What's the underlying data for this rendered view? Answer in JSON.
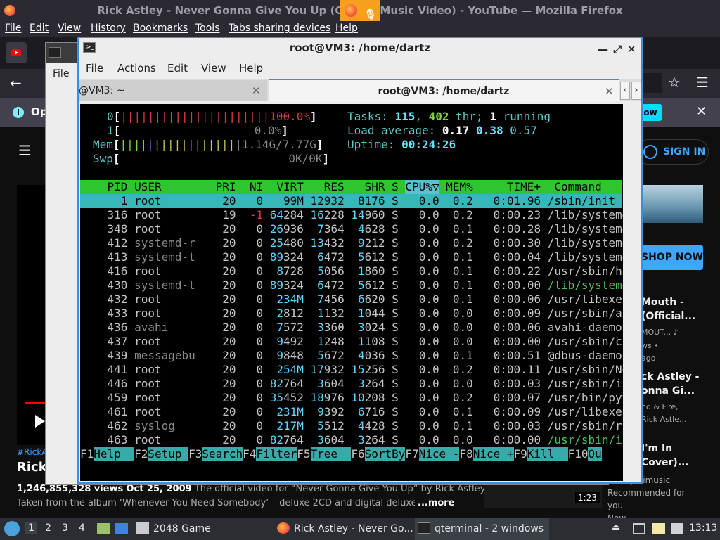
{
  "firefox": {
    "window_title": "Rick Astley - Never Gonna Give You Up (Official Music Video) - YouTube — Mozilla Firefox",
    "menu": [
      "File",
      "Edit",
      "View",
      "History",
      "Bookmarks",
      "Tools",
      "Tabs sharing devices",
      "Help"
    ],
    "notice_text": "Op",
    "notice_button": "ow",
    "youtube": {
      "sign_in": "SIGN IN",
      "shop_now": "SHOP NOW",
      "hashtag": "#RickA",
      "title": "Rick",
      "views": "1,246,855,328 views",
      "date": "Oct 25, 2009",
      "description_line1": "The official video for “Never Gonna Give You Up” by Rick Astley",
      "description_line2": "Taken from the album ‘Whenever You Need Somebody’ – deluxe 2CD and digital deluxe ou",
      "more": "...more",
      "rec": [
        {
          "title1": "Mouth -",
          "title2": "(Official...",
          "sub1": "MOUT... ♪",
          "sub2": "ws •",
          "sub3": "ago"
        },
        {
          "title1": "ck Astley -",
          "title2": "onna Gi...",
          "sub1": "nd & Fire,",
          "sub2": "Rick Astle..."
        },
        {
          "title1": "I'm In",
          "title2": "Cover)..."
        }
      ],
      "duration": "1:23",
      "recommender": [
        "ItsBugarimusic",
        "Recommended for",
        "you",
        "Now"
      ]
    }
  },
  "qterminal_back": {
    "menu_file": "File"
  },
  "qterminal": {
    "title": "root@VM3: /home/dartz",
    "menu": [
      "File",
      "Actions",
      "Edit",
      "View",
      "Help"
    ],
    "tabs": [
      {
        "label": "@VM3: ~",
        "active": false
      },
      {
        "label": "root@VM3: /home/dartz",
        "active": true
      }
    ]
  },
  "htop": {
    "cpu0": {
      "label": "0",
      "bar": "||||||||||||||||||||||",
      "value": "100.0%"
    },
    "cpu1": {
      "label": "1",
      "value": "0.0%"
    },
    "mem": {
      "label": "Mem",
      "bar": "||||||||||||||||||",
      "value": "1.14G/7.77G"
    },
    "swp": {
      "label": "Swp",
      "value": "0K/0K"
    },
    "tasks": {
      "label": "Tasks:",
      "total": "115",
      "threads": "402",
      "thr_label": "thr;",
      "running": "1",
      "running_label": "running"
    },
    "load": {
      "label": "Load average:",
      "v1": "0.17",
      "v5": "0.38",
      "v15": "0.57"
    },
    "uptime": {
      "label": "Uptime:",
      "value": "00:24:26"
    },
    "columns": [
      "PID",
      "USER",
      "PRI",
      "NI",
      "VIRT",
      "RES",
      "SHR",
      "S",
      "CPU%▽",
      "MEM%",
      "TIME+",
      "Command"
    ],
    "processes": [
      {
        "pid": "1",
        "user": "root",
        "pri": "20",
        "ni": "0",
        "virt": "99M",
        "res": "12932",
        "shr": "8176",
        "s": "S",
        "cpu": "0.0",
        "mem": "0.2",
        "time": "0:01.96",
        "cmd": "/sbin/init s"
      },
      {
        "pid": "316",
        "user": "root",
        "pri": "19",
        "ni": "-1",
        "virt": "64284",
        "res": "16228",
        "shr": "14960",
        "s": "S",
        "cpu": "0.0",
        "mem": "0.2",
        "time": "0:00.23",
        "cmd": "/lib/systemd"
      },
      {
        "pid": "348",
        "user": "root",
        "pri": "20",
        "ni": "0",
        "virt": "26936",
        "res": "7364",
        "shr": "4628",
        "s": "S",
        "cpu": "0.0",
        "mem": "0.1",
        "time": "0:00.28",
        "cmd": "/lib/systemd"
      },
      {
        "pid": "412",
        "user": "systemd-r",
        "pri": "20",
        "ni": "0",
        "virt": "25480",
        "res": "13432",
        "shr": "9212",
        "s": "S",
        "cpu": "0.0",
        "mem": "0.2",
        "time": "0:00.30",
        "cmd": "/lib/systemd"
      },
      {
        "pid": "413",
        "user": "systemd-t",
        "pri": "20",
        "ni": "0",
        "virt": "89324",
        "res": "6472",
        "shr": "5612",
        "s": "S",
        "cpu": "0.0",
        "mem": "0.1",
        "time": "0:00.04",
        "cmd": "/lib/systemd"
      },
      {
        "pid": "416",
        "user": "root",
        "pri": "20",
        "ni": "0",
        "virt": "8728",
        "res": "5056",
        "shr": "1860",
        "s": "S",
        "cpu": "0.0",
        "mem": "0.1",
        "time": "0:00.22",
        "cmd": "/usr/sbin/ha"
      },
      {
        "pid": "430",
        "user": "systemd-t",
        "pri": "20",
        "ni": "0",
        "virt": "89324",
        "res": "6472",
        "shr": "5612",
        "s": "S",
        "cpu": "0.0",
        "mem": "0.1",
        "time": "0:00.00",
        "cmd": "/lib/systemd"
      },
      {
        "pid": "432",
        "user": "root",
        "pri": "20",
        "ni": "0",
        "virt": "234M",
        "res": "7456",
        "shr": "6620",
        "s": "S",
        "cpu": "0.0",
        "mem": "0.1",
        "time": "0:00.06",
        "cmd": "/usr/libexec"
      },
      {
        "pid": "433",
        "user": "root",
        "pri": "20",
        "ni": "0",
        "virt": "2812",
        "res": "1132",
        "shr": "1044",
        "s": "S",
        "cpu": "0.0",
        "mem": "0.0",
        "time": "0:00.09",
        "cmd": "/usr/sbin/ac"
      },
      {
        "pid": "436",
        "user": "avahi",
        "pri": "20",
        "ni": "0",
        "virt": "7572",
        "res": "3360",
        "shr": "3024",
        "s": "S",
        "cpu": "0.0",
        "mem": "0.0",
        "time": "0:00.06",
        "cmd": "avahi-daemon"
      },
      {
        "pid": "437",
        "user": "root",
        "pri": "20",
        "ni": "0",
        "virt": "9492",
        "res": "1248",
        "shr": "1108",
        "s": "S",
        "cpu": "0.0",
        "mem": "0.0",
        "time": "0:00.00",
        "cmd": "/usr/sbin/cr"
      },
      {
        "pid": "439",
        "user": "messagebu",
        "pri": "20",
        "ni": "0",
        "virt": "9848",
        "res": "5672",
        "shr": "4036",
        "s": "S",
        "cpu": "0.0",
        "mem": "0.1",
        "time": "0:00.51",
        "cmd": "@dbus-daemon"
      },
      {
        "pid": "441",
        "user": "root",
        "pri": "20",
        "ni": "0",
        "virt": "254M",
        "res": "17932",
        "shr": "15256",
        "s": "S",
        "cpu": "0.0",
        "mem": "0.2",
        "time": "0:00.11",
        "cmd": "/usr/sbin/Ne"
      },
      {
        "pid": "446",
        "user": "root",
        "pri": "20",
        "ni": "0",
        "virt": "82764",
        "res": "3604",
        "shr": "3264",
        "s": "S",
        "cpu": "0.0",
        "mem": "0.0",
        "time": "0:00.03",
        "cmd": "/usr/sbin/ir"
      },
      {
        "pid": "459",
        "user": "root",
        "pri": "20",
        "ni": "0",
        "virt": "35452",
        "res": "18976",
        "shr": "10208",
        "s": "S",
        "cpu": "0.0",
        "mem": "0.2",
        "time": "0:00.07",
        "cmd": "/usr/bin/pyt"
      },
      {
        "pid": "461",
        "user": "root",
        "pri": "20",
        "ni": "0",
        "virt": "231M",
        "res": "9392",
        "shr": "6716",
        "s": "S",
        "cpu": "0.0",
        "mem": "0.1",
        "time": "0:00.09",
        "cmd": "/usr/libexec"
      },
      {
        "pid": "462",
        "user": "syslog",
        "pri": "20",
        "ni": "0",
        "virt": "217M",
        "res": "5512",
        "shr": "4428",
        "s": "S",
        "cpu": "0.0",
        "mem": "0.1",
        "time": "0:00.03",
        "cmd": "/usr/sbin/rs"
      },
      {
        "pid": "463",
        "user": "root",
        "pri": "20",
        "ni": "0",
        "virt": "82764",
        "res": "3604",
        "shr": "3264",
        "s": "S",
        "cpu": "0.0",
        "mem": "0.0",
        "time": "0:00.00",
        "cmd": "/usr/sbin/ir"
      }
    ],
    "fkeys": [
      {
        "key": "F1",
        "label": "Help  "
      },
      {
        "key": "F2",
        "label": "Setup "
      },
      {
        "key": "F3",
        "label": "Search"
      },
      {
        "key": "F4",
        "label": "Filter"
      },
      {
        "key": "F5",
        "label": "Tree  "
      },
      {
        "key": "F6",
        "label": "SortBy"
      },
      {
        "key": "F7",
        "label": "Nice -"
      },
      {
        "key": "F8",
        "label": "Nice +"
      },
      {
        "key": "F9",
        "label": "Kill  "
      },
      {
        "key": "F10",
        "label": "Qu"
      }
    ],
    "colors": {
      "header": "#2ec52e",
      "selected": "#36b8b8",
      "fkey_bg": "#3aa9a9"
    }
  },
  "taskbar": {
    "workspaces": [
      "1",
      "2",
      "3",
      "4"
    ],
    "game_task": "2048 Game",
    "firefox_task": "Rick Astley - Never Go...",
    "terminal_task": "qterminal - 2 windows",
    "clock": "13:13"
  }
}
